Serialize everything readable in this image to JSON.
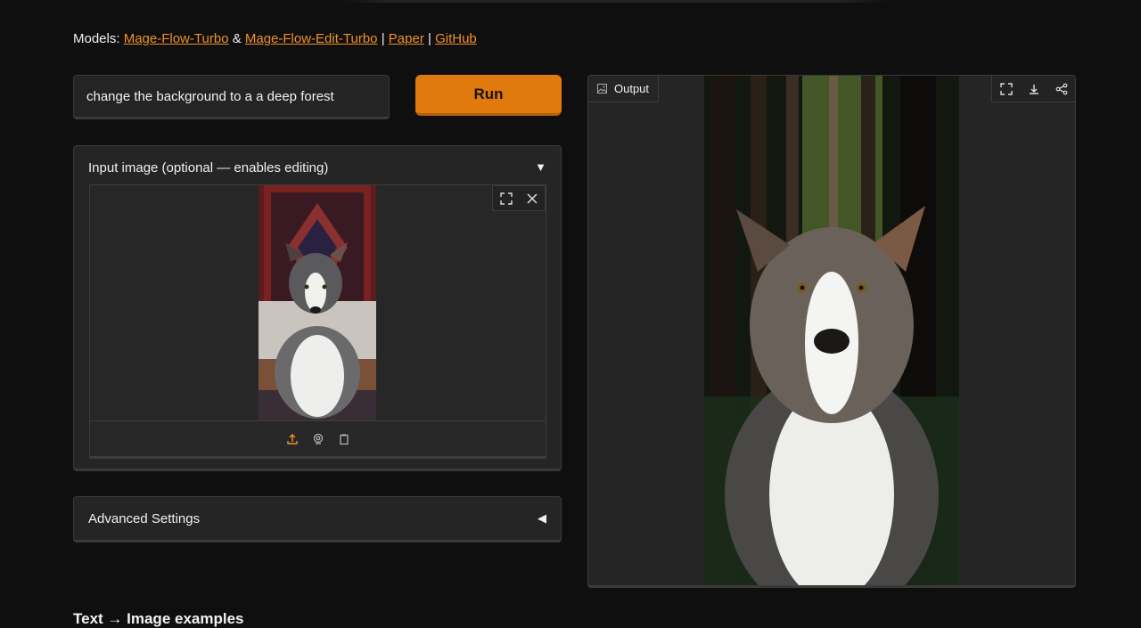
{
  "header": {
    "models_label": "Models:",
    "links": [
      {
        "label": "Mage-Flow-Turbo"
      },
      {
        "label": "Mage-Flow-Edit-Turbo"
      },
      {
        "label": "Paper"
      },
      {
        "label": "GitHub"
      }
    ],
    "amp": "&",
    "pipe": "|"
  },
  "prompt": {
    "value": "change the background to a a deep forest"
  },
  "run_label": "Run",
  "input_panel": {
    "title": "Input image (optional — enables editing)",
    "toggle": "▼",
    "tools": [
      "fullscreen-icon",
      "close-icon"
    ],
    "upload_icons": [
      "upload-icon",
      "webcam-icon",
      "clipboard-icon"
    ]
  },
  "advanced": {
    "label": "Advanced Settings",
    "toggle": "◀"
  },
  "output": {
    "label": "Output",
    "tools": [
      "fullscreen-icon",
      "download-icon",
      "share-icon"
    ]
  },
  "examples_title": "Text → Image examples",
  "colors": {
    "accent": "#e07a0c",
    "link": "#f0902a",
    "background": "#0f0f10",
    "panel": "#252525"
  }
}
